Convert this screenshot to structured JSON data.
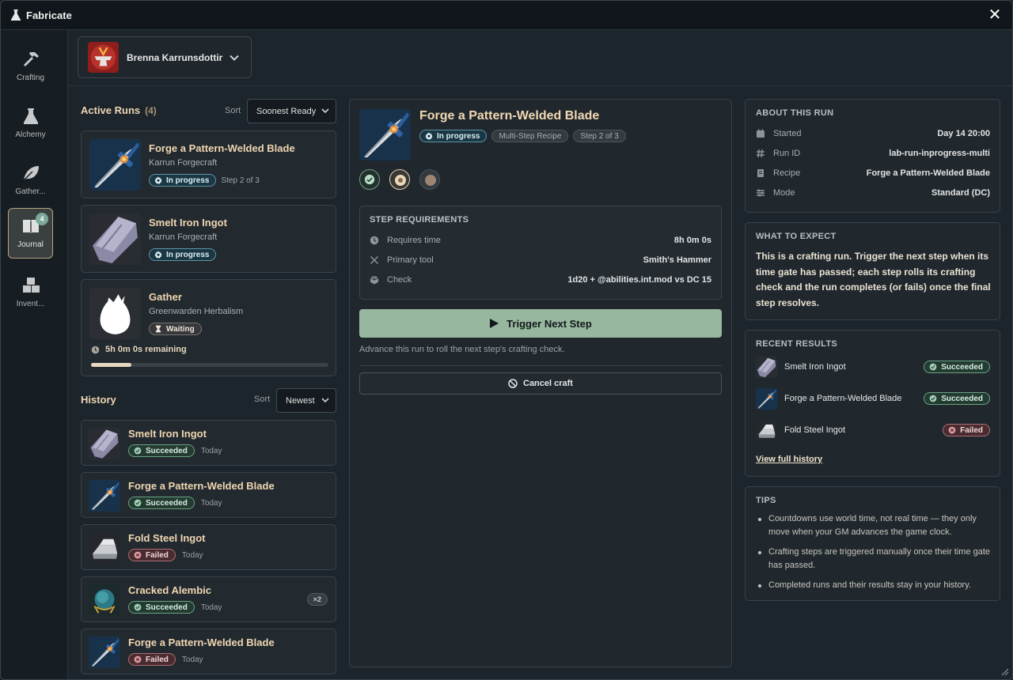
{
  "app": {
    "title": "Fabricate",
    "close_label": "✕"
  },
  "sidebar": {
    "items": [
      {
        "label": "Crafting",
        "icon": "hammer-icon"
      },
      {
        "label": "Alchemy",
        "icon": "flask-icon"
      },
      {
        "label": "Gather...",
        "icon": "leaf-icon"
      },
      {
        "label": "Journal",
        "icon": "book-icon",
        "badge": "4",
        "active": true
      },
      {
        "label": "Invent...",
        "icon": "boxes-icon"
      }
    ]
  },
  "character": {
    "name": "Brenna Karrunsdottir"
  },
  "active_runs": {
    "title": "Active Runs",
    "count": "(4)",
    "sort_label": "Sort",
    "sort_value": "Soonest Ready",
    "items": [
      {
        "title": "Forge a Pattern-Welded Blade",
        "subtitle": "Karrun Forgecraft",
        "status": "In progress",
        "step": "Step 2 of 3"
      },
      {
        "title": "Smelt Iron Ingot",
        "subtitle": "Karrun Forgecraft",
        "status": "In progress"
      },
      {
        "title": "Gather",
        "subtitle": "Greenwarden Herbalism",
        "status": "Waiting",
        "remaining": "5h 0m 0s remaining",
        "progress": 0.17
      }
    ]
  },
  "history": {
    "title": "History",
    "sort_label": "Sort",
    "sort_value": "Newest",
    "items": [
      {
        "title": "Smelt Iron Ingot",
        "status": "Succeeded",
        "date": "Today"
      },
      {
        "title": "Forge a Pattern-Welded Blade",
        "status": "Succeeded",
        "date": "Today"
      },
      {
        "title": "Fold Steel Ingot",
        "status": "Failed",
        "date": "Today"
      },
      {
        "title": "Cracked Alembic",
        "status": "Succeeded",
        "date": "Today",
        "multiplier": "×2"
      },
      {
        "title": "Forge a Pattern-Welded Blade",
        "status": "Failed",
        "date": "Today"
      }
    ]
  },
  "detail": {
    "title": "Forge a Pattern-Welded Blade",
    "status": "In progress",
    "tag1": "Multi-Step Recipe",
    "tag2": "Step 2 of 3",
    "requirements": {
      "title": "STEP REQUIREMENTS",
      "rows": [
        {
          "key": "Requires time",
          "value": "8h 0m 0s"
        },
        {
          "key": "Primary tool",
          "value": "Smith's Hammer"
        },
        {
          "key": "Check",
          "value": "1d20 + @abilities.int.mod vs DC 15"
        }
      ]
    },
    "trigger_label": "Trigger Next Step",
    "hint": "Advance this run to roll the next step's crafting check.",
    "cancel_label": "Cancel craft"
  },
  "about": {
    "title": "ABOUT THIS RUN",
    "rows": [
      {
        "key": "Started",
        "value": "Day 14 20:00"
      },
      {
        "key": "Run ID",
        "value": "lab-run-inprogress-multi"
      },
      {
        "key": "Recipe",
        "value": "Forge a Pattern-Welded Blade"
      },
      {
        "key": "Mode",
        "value": "Standard (DC)"
      }
    ]
  },
  "expect": {
    "title": "WHAT TO EXPECT",
    "text": "This is a crafting run. Trigger the next step when its time gate has passed; each step rolls its crafting check and the run completes (or fails) once the final step resolves."
  },
  "recent": {
    "title": "RECENT RESULTS",
    "items": [
      {
        "name": "Smelt Iron Ingot",
        "status": "Succeeded"
      },
      {
        "name": "Forge a Pattern-Welded Blade",
        "status": "Succeeded"
      },
      {
        "name": "Fold Steel Ingot",
        "status": "Failed"
      }
    ],
    "view_all": "View full history"
  },
  "tips": {
    "title": "TIPS",
    "items": [
      "Countdowns use world time, not real time — they only move when your GM advances the game clock.",
      "Crafting steps are triggered manually once their time gate has passed.",
      "Completed runs and their results stay in your history."
    ]
  },
  "colors": {
    "accent": "#97b89e",
    "title": "#f0d6b0",
    "success": "#6aa286",
    "fail": "#aa6e73",
    "progress": "#5d94a8"
  }
}
